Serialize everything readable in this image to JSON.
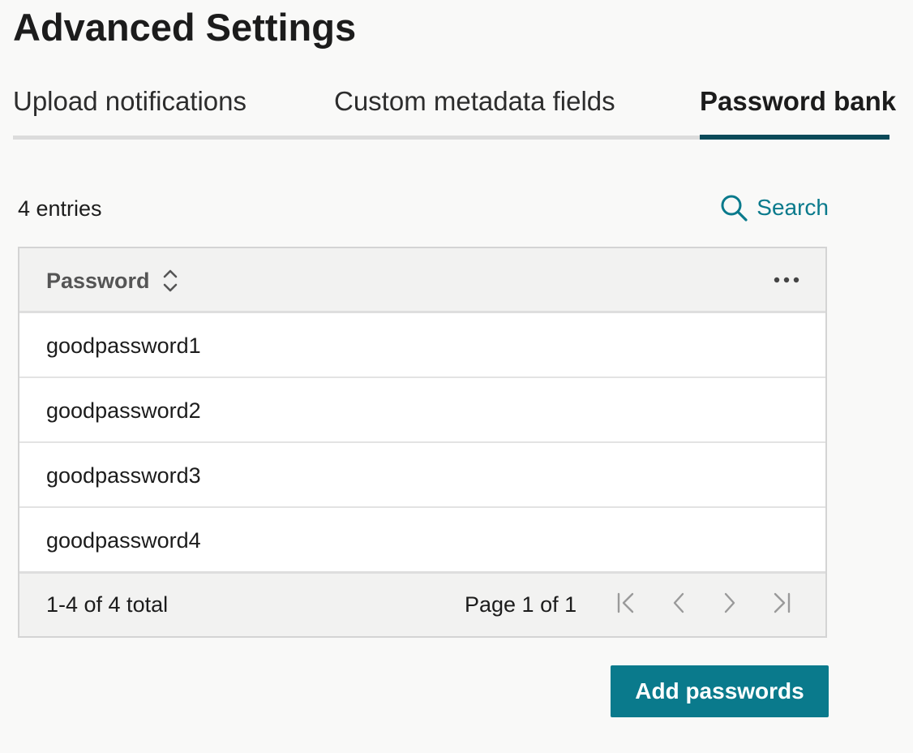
{
  "page": {
    "title": "Advanced Settings"
  },
  "tabs": [
    {
      "label": "Upload notifications",
      "active": false
    },
    {
      "label": "Custom metadata fields",
      "active": false
    },
    {
      "label": "Password bank",
      "active": true
    }
  ],
  "toolbar": {
    "entries_count": "4 entries",
    "search_label": "Search"
  },
  "table": {
    "columns": [
      "Password"
    ],
    "rows": [
      "goodpassword1",
      "goodpassword2",
      "goodpassword3",
      "goodpassword4"
    ],
    "footer": {
      "total": "1-4 of 4 total",
      "page_info": "Page 1 of 1"
    }
  },
  "actions": {
    "add_label": "Add passwords"
  },
  "colors": {
    "accent": "#0a7a8c",
    "tab_indicator": "#0b4a59",
    "background": "#f9f9f8"
  },
  "icons": {
    "search": "search-icon",
    "sort": "sort-icon",
    "more": "more-horizontal-icon",
    "first": "first-page-icon",
    "prev": "chevron-left-icon",
    "next": "chevron-right-icon",
    "last": "last-page-icon"
  }
}
